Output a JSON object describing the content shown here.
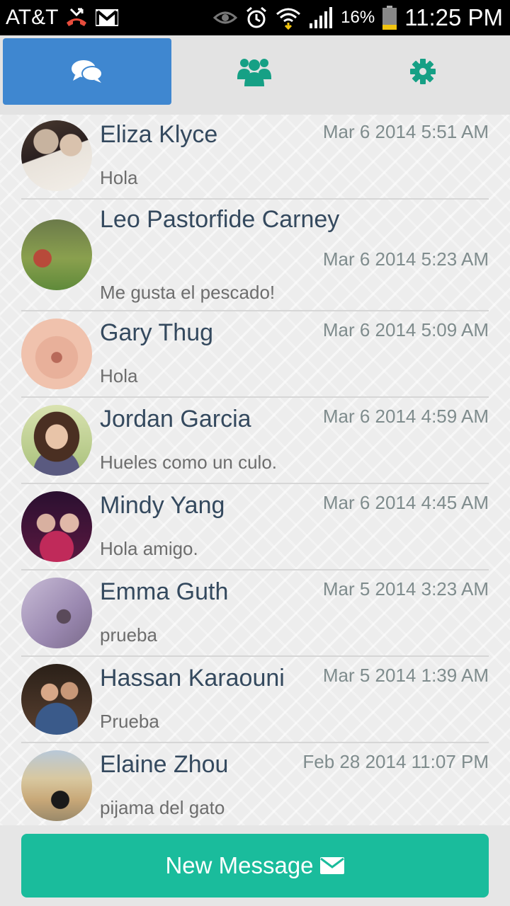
{
  "status_bar": {
    "carrier": "AT&T",
    "battery_percent": "16%",
    "time": "11:25 PM",
    "icons": [
      "missed-call-icon",
      "gmail-icon",
      "eye-icon",
      "alarm-icon",
      "wifi-icon",
      "signal-icon",
      "battery-icon"
    ]
  },
  "tabs": [
    {
      "icon": "chat-bubbles-icon",
      "active": true
    },
    {
      "icon": "group-icon",
      "active": false
    },
    {
      "icon": "gear-icon",
      "active": false
    }
  ],
  "colors": {
    "tab_active": "#3f87d0",
    "tab_icon": "#16a085",
    "button": "#1abc9c",
    "name_text": "#34495e",
    "time_text": "#7f8c8d"
  },
  "conversations": [
    {
      "name": "Eliza Klyce",
      "time": "Mar 6 2014 5:51 AM",
      "message": "Hola"
    },
    {
      "name": "Leo Pastorfide Carney",
      "time": "Mar 6 2014 5:23 AM",
      "message": "Me gusta el pescado!"
    },
    {
      "name": "Gary Thug",
      "time": "Mar 6 2014 5:09 AM",
      "message": "Hola"
    },
    {
      "name": "Jordan Garcia",
      "time": "Mar 6 2014 4:59 AM",
      "message": "Hueles como un culo."
    },
    {
      "name": "Mindy Yang",
      "time": "Mar 6 2014 4:45 AM",
      "message": "Hola amigo."
    },
    {
      "name": "Emma Guth",
      "time": "Mar 5 2014 3:23 AM",
      "message": "prueba"
    },
    {
      "name": "Hassan Karaouni",
      "time": "Mar 5 2014 1:39 AM",
      "message": "Prueba"
    },
    {
      "name": "Elaine Zhou",
      "time": "Feb 28 2014 11:07 PM",
      "message": "pijama del gato"
    }
  ],
  "new_message_button": {
    "label": "New Message",
    "icon": "envelope-icon"
  }
}
